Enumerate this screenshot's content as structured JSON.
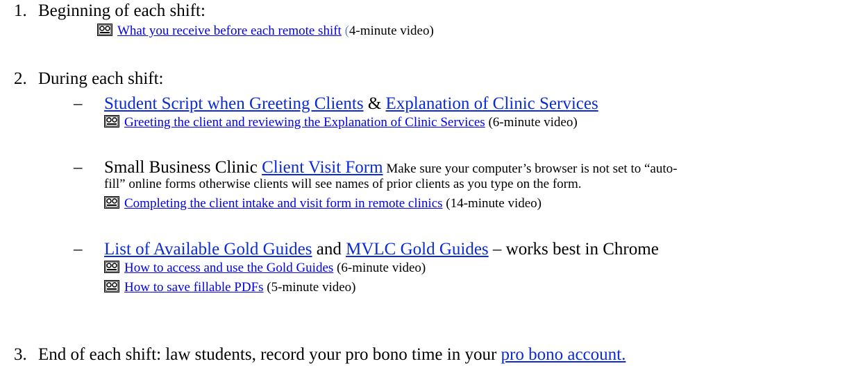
{
  "items": [
    {
      "number": "1.",
      "heading": "Beginning of each shift:",
      "video": {
        "link": "What you receive before each remote shift",
        "open_paren": " (",
        "note": "4-minute video)"
      }
    },
    {
      "number": "2.",
      "heading": "During each shift:",
      "bullets": [
        {
          "dash": "–",
          "link1": "Student Script when Greeting Clients",
          "amp": " & ",
          "link2": "Explanation of Clinic Services",
          "video": {
            "link": "Greeting the client and reviewing the Explanation of Clinic Services",
            "note": " (6-minute video)"
          }
        },
        {
          "dash": "–",
          "text": "Small Business Clinic ",
          "link": "Client Visit Form",
          "note_line1": " Make sure your computer’s browser is not set to “auto-",
          "note_line2": "fill” online forms otherwise clients will see names of prior clients as you type on the form.",
          "video": {
            "link": "Completing the client intake and visit form in remote clinics",
            "note": " (14-minute video)"
          }
        },
        {
          "dash": "–",
          "link1": "List of Available Gold Guides",
          "and": " and ",
          "link2": "MVLC Gold Guides",
          "tail": " – works best in Chrome",
          "videos": [
            {
              "link": "How to access and use the Gold Guides",
              "note": " (6-minute video)"
            },
            {
              "link": "How to save fillable PDFs",
              "note": " (5-minute video)"
            }
          ]
        }
      ]
    },
    {
      "number": "3.",
      "text": "End of each shift: law students, record your pro bono time in your ",
      "link": "pro bono account."
    }
  ]
}
